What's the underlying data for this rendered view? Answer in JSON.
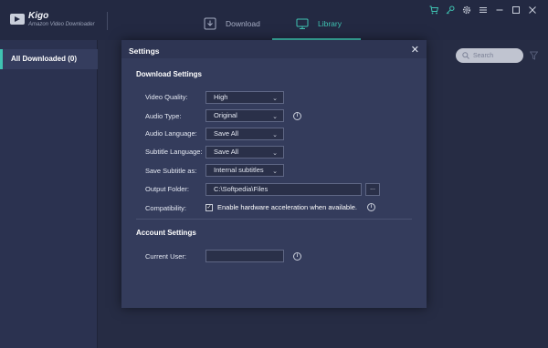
{
  "app": {
    "name": "Kigo",
    "subtitle": "Amazon Video Downloader"
  },
  "nav": {
    "download_label": "Download",
    "library_label": "Library",
    "active_color": "#3fc3b2"
  },
  "window_controls": {
    "icons": [
      "cart-icon",
      "key-icon",
      "gear-icon",
      "menu-icon",
      "minimize-icon",
      "maximize-icon",
      "close-icon"
    ]
  },
  "sidebar": {
    "items": [
      {
        "label": "All Downloaded (0)",
        "active": true
      }
    ]
  },
  "search": {
    "placeholder": "Search"
  },
  "settings": {
    "title": "Settings",
    "download_section": "Download Settings",
    "rows": {
      "video_quality": {
        "label": "Video Quality:",
        "value": "High"
      },
      "audio_type": {
        "label": "Audio Type:",
        "value": "Original"
      },
      "audio_language": {
        "label": "Audio Language:",
        "value": "Save All"
      },
      "subtitle_language": {
        "label": "Subtitle Language:",
        "value": "Save All"
      },
      "save_subtitle_as": {
        "label": "Save Subtitle as:",
        "value": "Internal subtitles"
      },
      "output_folder": {
        "label": "Output Folder:",
        "value": "C:\\Softpedia\\Files",
        "browse": "..."
      },
      "compatibility": {
        "label": "Compatibility:",
        "checkbox_label": "Enable hardware acceleration when available.",
        "checked": true
      }
    },
    "account_section": "Account Settings",
    "current_user": {
      "label": "Current User:",
      "value": ""
    }
  }
}
